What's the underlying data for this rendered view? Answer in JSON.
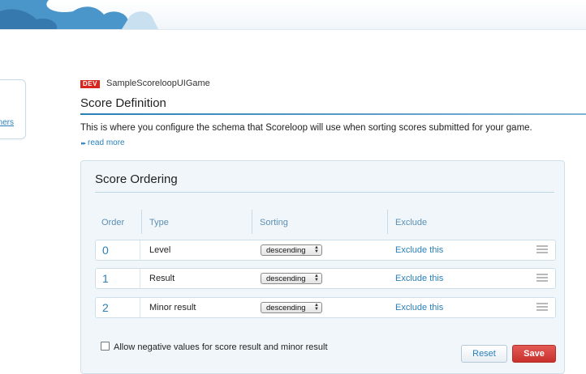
{
  "header": {
    "badge": "DEV",
    "app_name": "SampleScoreloopUIGame",
    "title": "Score Definition",
    "description": "This is where you configure the schema that Scoreloop will use when sorting scores submitted for your game.",
    "read_more": "read more",
    "read_more_arrows": "▸▸"
  },
  "sidebar": {
    "link_fragment": "ners"
  },
  "panel": {
    "title": "Score Ordering",
    "columns": [
      "Order",
      "Type",
      "Sorting",
      "Exclude"
    ],
    "rows": [
      {
        "order": "0",
        "type": "Level",
        "sorting": "descending",
        "exclude": "Exclude this"
      },
      {
        "order": "1",
        "type": "Result",
        "sorting": "descending",
        "exclude": "Exclude this"
      },
      {
        "order": "2",
        "type": "Minor result",
        "sorting": "descending",
        "exclude": "Exclude this"
      }
    ],
    "negative_label": "Allow negative values for score result and minor result",
    "negative_checked": false,
    "reset_label": "Reset",
    "save_label": "Save"
  },
  "colors": {
    "accent": "#2a7fb6",
    "save": "#c9302c",
    "badge": "#d8261c",
    "panel_bg": "#f1f6fa"
  }
}
